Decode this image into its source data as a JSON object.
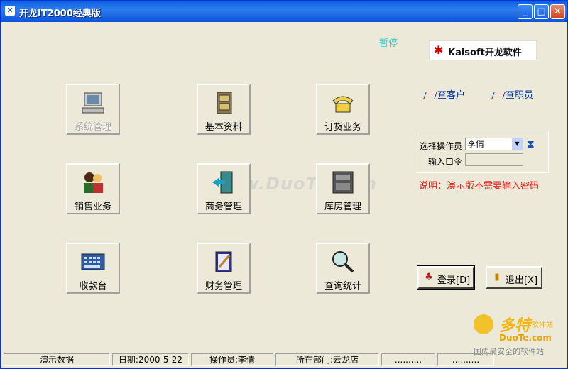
{
  "window": {
    "title": "开龙IT2000经典版",
    "controls": {
      "minimize": "_",
      "maximize": "□",
      "close": "✕"
    }
  },
  "status_top": "暂停",
  "logo": {
    "text": "Kaisoft开龙软件",
    "icon": "kaisoft-logo"
  },
  "tiles": [
    {
      "label": "系统管理",
      "icon": "computer-icon",
      "enabled": false
    },
    {
      "label": "基本资料",
      "icon": "cabinet-icon",
      "enabled": true
    },
    {
      "label": "订货业务",
      "icon": "telephone-icon",
      "enabled": true
    },
    {
      "label": "销售业务",
      "icon": "people-icon",
      "enabled": true
    },
    {
      "label": "商务管理",
      "icon": "door-icon",
      "enabled": true
    },
    {
      "label": "库房管理",
      "icon": "warehouse-icon",
      "enabled": true
    },
    {
      "label": "收款台",
      "icon": "calculator-icon",
      "enabled": true
    },
    {
      "label": "财务管理",
      "icon": "notebook-icon",
      "enabled": true
    },
    {
      "label": "查询统计",
      "icon": "magnifier-icon",
      "enabled": true
    }
  ],
  "links": {
    "customer": "查客户",
    "employee": "查职员"
  },
  "login": {
    "operator_label": "选择操作员",
    "operator_value": "李倩",
    "password_label": "输入口令",
    "password_value": ""
  },
  "note": "说明：演示版不需要输入密码",
  "buttons": {
    "login": "登录[D]",
    "exit": "退出[X]"
  },
  "statusbar": {
    "mode": "演示数据",
    "date": "日期:2000-5-22",
    "operator": "操作员:李倩",
    "department": "所在部门:云龙店",
    "extra1": "..........",
    "extra2": ".........."
  },
  "watermark": {
    "center": "www.DuoTe.com",
    "brand": "多特",
    "brand_small": "软件站",
    "site": "DuoTe.com",
    "slogan": "国内最安全的软件站"
  },
  "colors": {
    "titlebar": "#0a5fe0",
    "pause": "#33cccc",
    "note": "#e82020",
    "link": "#003399"
  }
}
